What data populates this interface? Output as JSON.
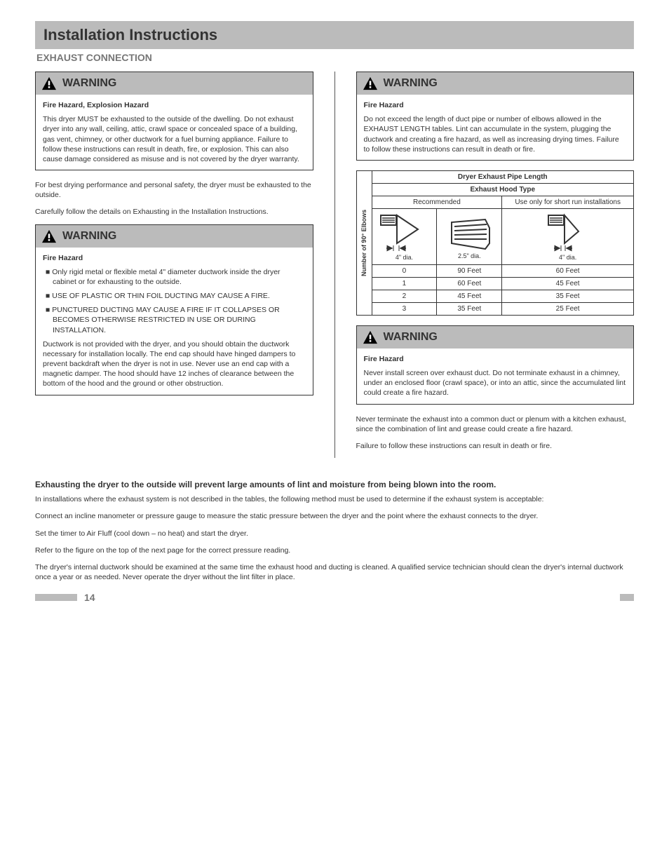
{
  "header": "Installation Instructions",
  "subheader": "EXHAUST CONNECTION",
  "col1": {
    "warning1": {
      "label": "WARNING",
      "lead": "Fire Hazard, Explosion Hazard",
      "body": "This dryer MUST be exhausted to the outside of the dwelling. Do not exhaust dryer into any wall, ceiling, attic, crawl space or concealed space of a building, gas vent, chimney, or other ductwork for a fuel burning appliance. Failure to follow these instructions can result in death, fire, or explosion. This can also cause damage considered as misuse and is not covered by the dryer warranty."
    },
    "para1": "For best drying performance and personal safety, the dryer must be exhausted to the outside.",
    "para2": "Carefully follow the details on Exhausting in the Installation Instructions.",
    "warning2": {
      "label": "WARNING",
      "lead": "Fire Hazard",
      "l1": "Only rigid metal or flexible metal 4\" diameter ductwork inside the dryer cabinet or for exhausting to the outside.",
      "l2": "USE OF PLASTIC OR THIN FOIL DUCTING MAY CAUSE A FIRE.",
      "l3": "PUNCTURED DUCTING MAY CAUSE A FIRE IF IT COLLAPSES OR BECOMES OTHERWISE RESTRICTED IN USE OR DURING INSTALLATION.",
      "body": "Ductwork is not provided with the dryer, and you should obtain the ductwork necessary for installation locally. The end cap should have hinged dampers to prevent backdraft when the dryer is not in use. Never use an end cap with a magnetic damper. The hood should have 12 inches of clearance between the bottom of the hood and the ground or other obstruction."
    }
  },
  "col2": {
    "warning1": {
      "label": "WARNING",
      "lead": "Fire Hazard",
      "body": "Do not exceed the length of duct pipe or number of elbows allowed in the EXHAUST LENGTH tables. Lint can accumulate in the system, plugging the ductwork and creating a fire hazard, as well as increasing drying times. Failure to follow these instructions can result in death or fire."
    },
    "table": {
      "rotlabel": "Number of 90° Elbows",
      "hdr_main": "Dryer Exhaust Pipe Length",
      "hdr_type": "Exhaust Hood Type",
      "col_a_sub": "Recommended",
      "col_b_sub": "Use only for short run installations",
      "col_a_dim": "4\" dia.",
      "col_a_dim2": "2.5\" dia.",
      "col_b_dim": "4\" dia.",
      "rows": [
        {
          "n": "0",
          "a": "90 Feet",
          "b": "60 Feet"
        },
        {
          "n": "1",
          "a": "60 Feet",
          "b": "45 Feet"
        },
        {
          "n": "2",
          "a": "45 Feet",
          "b": "35 Feet"
        },
        {
          "n": "3",
          "a": "35 Feet",
          "b": "25 Feet"
        }
      ]
    },
    "warning2": {
      "label": "WARNING",
      "lead": "Fire Hazard",
      "body": "Never install screen over exhaust duct. Do not terminate exhaust in a chimney, under an enclosed floor (crawl space), or into an attic, since the accumulated lint could create a fire hazard."
    },
    "para1": "Never terminate the exhaust into a common duct or plenum with a kitchen exhaust, since the combination of lint and grease could create a fire hazard.",
    "para2": "Failure to follow these instructions can result in death or fire."
  },
  "bottom": {
    "heading": "Exhausting the dryer to the outside will prevent large amounts of lint and moisture from being blown into the room.",
    "p1": "In installations where the exhaust system is not described in the tables, the following method must be used to determine if the exhaust system is acceptable:",
    "p2": "Connect an incline manometer or pressure gauge to measure the static pressure between the dryer and the point where the exhaust connects to the dryer.",
    "p3": "Set the timer to Air Fluff (cool down – no heat) and start the dryer.",
    "p4": "Refer to the figure on the top of the next page for the correct pressure reading.",
    "p5": "The dryer's internal ductwork should be examined at the same time the exhaust hood and ducting is cleaned. A qualified service technician should clean the dryer's internal ductwork once a year or as needed. Never operate the dryer without the lint filter in place."
  },
  "footer": {
    "page": "14"
  }
}
